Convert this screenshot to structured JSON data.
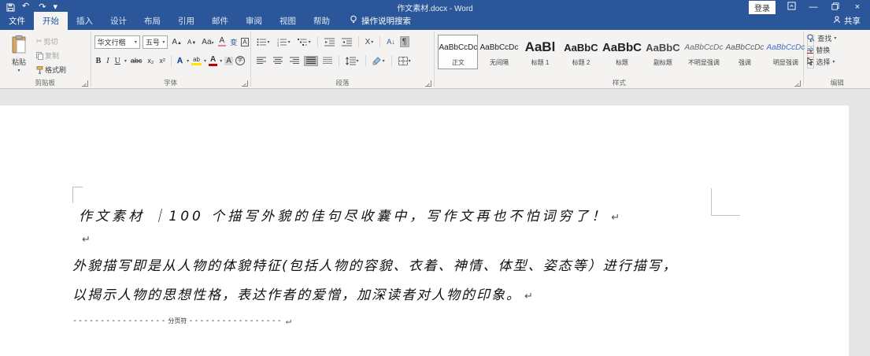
{
  "titlebar": {
    "title": "作文素材.docx - Word",
    "sign_in": "登录",
    "share": "共享",
    "tell_me": "操作说明搜索"
  },
  "tabs": [
    {
      "label": "文件",
      "kind": "file"
    },
    {
      "label": "开始",
      "kind": "active"
    },
    {
      "label": "插入",
      "kind": "normal"
    },
    {
      "label": "设计",
      "kind": "normal"
    },
    {
      "label": "布局",
      "kind": "normal"
    },
    {
      "label": "引用",
      "kind": "normal"
    },
    {
      "label": "邮件",
      "kind": "normal"
    },
    {
      "label": "审阅",
      "kind": "normal"
    },
    {
      "label": "视图",
      "kind": "normal"
    },
    {
      "label": "帮助",
      "kind": "normal"
    }
  ],
  "ribbon": {
    "clipboard": {
      "label": "剪贴板",
      "paste": "粘贴",
      "cut": "剪切",
      "copy": "复制",
      "format_painter": "格式刷"
    },
    "font": {
      "label": "字体",
      "font_name": "华文行楷",
      "font_size": "五号"
    },
    "paragraph": {
      "label": "段落"
    },
    "styles": {
      "label": "样式",
      "items": [
        {
          "sample": "AaBbCcDc",
          "name": "正文",
          "cls": "s-normal",
          "selected": true
        },
        {
          "sample": "AaBbCcDc",
          "name": "无间隔",
          "cls": "s-normal",
          "selected": false
        },
        {
          "sample": "AaBl",
          "name": "标题 1",
          "cls": "s-h1",
          "selected": false
        },
        {
          "sample": "AaBbC",
          "name": "标题 2",
          "cls": "s-h2",
          "selected": false
        },
        {
          "sample": "AaBbC",
          "name": "标题",
          "cls": "s-title",
          "selected": false
        },
        {
          "sample": "AaBbC",
          "name": "副标题",
          "cls": "s-sub",
          "selected": false
        },
        {
          "sample": "AaBbCcDc",
          "name": "不明显强调",
          "cls": "s-em1",
          "selected": false
        },
        {
          "sample": "AaBbCcDc",
          "name": "强调",
          "cls": "s-em2",
          "selected": false
        },
        {
          "sample": "AaBbCcDc",
          "name": "明显强调",
          "cls": "s-em3",
          "selected": false
        }
      ]
    },
    "editing": {
      "label": "编辑",
      "find": "查找",
      "replace": "替换",
      "select": "选择"
    }
  },
  "icons": {
    "dropdown": "▾",
    "undo": "↶",
    "redo": "↷",
    "minimize": "—",
    "close": "×",
    "scissors": "✂",
    "bold": "B",
    "italic": "I",
    "underline": "U",
    "strike": "abc",
    "subscript": "x₂",
    "superscript": "x²",
    "grow_font": "A",
    "shrink_font": "A",
    "change_case": "Aa",
    "clear_format": "A",
    "phonetic_guide": "变",
    "char_border": "A",
    "text_effects": "A",
    "highlight": "ab",
    "font_color": "A",
    "char_shading": "A",
    "enclose_char": "字",
    "asian_layout": "X",
    "sort": "A↓",
    "pilcrow": "¶",
    "paragraph_mark": "↵"
  },
  "document": {
    "lines": [
      {
        "text": "作文素材 ｜100 个描写外貌的佳句尽收囊中，写作文再也不怕词穷了！",
        "mark": true
      },
      {
        "text": "",
        "mark": true
      },
      {
        "text": "外貌描写即是从人物的体貌特征(包括人物的容貌、衣着、神情、体型、姿态等）进行描写，",
        "mark": false
      },
      {
        "text": "以揭示人物的思想性格，表达作者的爱憎，加深读者对人物的印象。",
        "mark": true
      }
    ],
    "page_break": {
      "dashes_left": "-----------------",
      "label": "分页符",
      "dashes_right": "-----------------",
      "mark": true
    }
  }
}
